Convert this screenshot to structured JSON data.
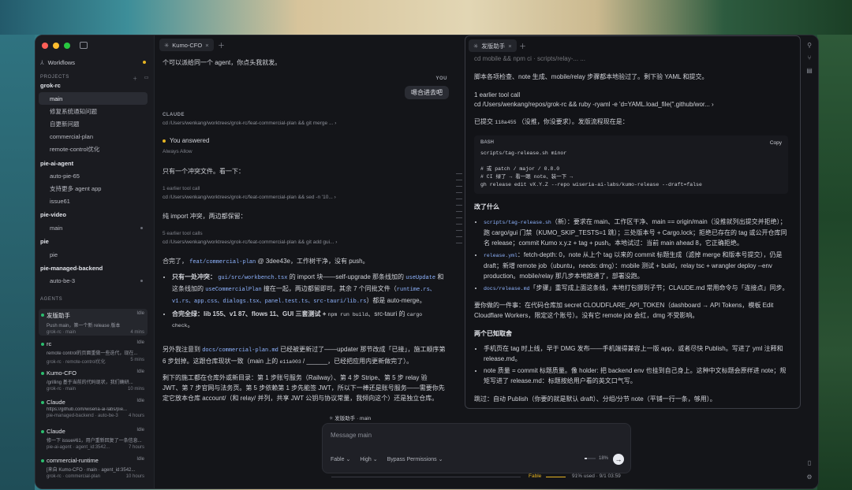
{
  "sidebar": {
    "workflows": "Workflows",
    "projects_header": "PROJECTS",
    "agents_header": "AGENTS",
    "projects": [
      {
        "name": "grok-rc",
        "branches": [
          "main",
          "修复系统通知问题",
          "自更新问题",
          "commercial-plan",
          "remote-control优化"
        ]
      },
      {
        "name": "pie-ai-agent",
        "branches": [
          "auto-pie-65",
          "支持更多 agent app",
          "issue61"
        ]
      },
      {
        "name": "pie-video",
        "branches": [
          "main"
        ]
      },
      {
        "name": "pie",
        "branches": [
          "pie"
        ]
      },
      {
        "name": "pie-managed-backend",
        "branches": [
          "auto-be-3"
        ]
      }
    ],
    "agents": [
      {
        "name": "发版助手",
        "status": "Idle",
        "msg": "Push main，第一个新 release 版本",
        "repo": "grok-rc · main",
        "time": "4 mins"
      },
      {
        "name": "rc",
        "status": "Idle",
        "msg": "remote control的页面重做一些迭代，现在...",
        "repo": "grok-rc · remote-control优化",
        "time": "5 mins"
      },
      {
        "name": "Kumo-CFO",
        "status": "Idle",
        "msg": "/grilling 基于当前的代码现状，我们确研...",
        "repo": "grok-rc · main",
        "time": "10 mins"
      },
      {
        "name": "Claude",
        "status": "Idle",
        "msg": "https://github.com/wiseria-ai-labs/pie...",
        "repo": "pie-managed-backend · auto-be-3",
        "time": "4 hours"
      },
      {
        "name": "Claude",
        "status": "Idle",
        "msg": "修一下 issue#61，用户重新回复了一条信息...",
        "repo": "pie-ai-agent · agent_id:3542...",
        "time": "7 hours"
      },
      {
        "name": "commercial-runtime",
        "status": "Idle",
        "msg": "[来自 Kumo-CFO · main · agent_id:3542...",
        "repo": "grok-rc · commercial-plan",
        "time": "10 hours"
      }
    ]
  },
  "center": {
    "tab": "Kumo-CFO",
    "line1": "个可以派给同一个 agent，你点头我就发。",
    "you_label": "YOU",
    "you_msg": "嗯合进去吧",
    "claude_label": "CLAUDE",
    "cmd1": "cd /Users/wenkang/worktrees/grok-rc/feat-commercial-plan && git merge ...",
    "answered": "You answered",
    "always_allow": "Always Allow",
    "conflict": "只有一个冲突文件。看一下：",
    "tc1": "1 earlier tool call",
    "cmd2": "cd /Users/wenkang/worktrees/grok-rc/feat-commercial-plan && sed -n '10...",
    "import_line": "纯 import 冲突，两边都保留：",
    "tc2": "5 earlier tool calls",
    "cmd3": "cd /Users/wenkang/worktrees/grok-rc/feat-commercial-plan && git add gui...",
    "merged_a": "合完了，",
    "merged_branch": "feat/commercial-plan",
    "merged_b": "@ 3dee43e，工作树干净，没有 push。",
    "b1_a": "只有一处冲突：",
    "b1_file": "gui/src/workbench.tsx",
    "b1_b": "的 import 块——self-upgrade 那条线加的",
    "b1_c": "useUpdate",
    "b1_d": "和这条线加的",
    "b1_e": "useCommercialPlan",
    "b1_f": "撞在一起，两边都留即可。其余 7 个同批文件（",
    "b1_g": "runtime.rs、v1.rs、app.css、dialogs.tsx、panel.test.ts、src-tauri/lib.rs",
    "b1_h": "）都是 auto-merge。",
    "b2_a": "合完全绿：lib 155、v1 87、flows 11、GUI 三套测试 +",
    "b2_b": "npm run build",
    "b2_c": "、src-tauri 的",
    "b2_d": "cargo check",
    "b2_e": "。",
    "p_a": "另外我注意到",
    "p_file": "docs/commercial-plan.md",
    "p_b": "已经被更新过了——updater 那节改成「已接」，施工顺序第 6 步划掉。这跟仓库现状一致（main 上的",
    "p_hash": "e11a003",
    "p_c": "/ ______，已经把应用内更新做完了）。",
    "p2": "剩下的施工都在仓库外或新目录：第 1 步账号服务（Railway）、第 4 步 Stripe、第 5 步 relay 验 JWT、第 7 步官网与法务页。第 5 步依赖第 1 步先能签 JWT，所以下一棒还是账号服务——需要你先定它放本仓库 account/（和 relay/ 并列，共享 JWT 公钥与协议常量，我倾向这个）还是独立仓库。"
  },
  "composer": {
    "title": "发版助手 · main",
    "placeholder": "Message main",
    "model": "Fable",
    "effort": "High",
    "permissions": "Bypass Permissions",
    "context_pct": "18%",
    "context_fill": 0.18,
    "status_model": "Fable",
    "status_usage": "91% used · 9/1 03:59"
  },
  "right": {
    "tab": "发版助手",
    "cut_line": "cd mobile && npm ci · scripts/relay-... ...",
    "p1": "脚本各项检查、note 生成、mobile/relay 步骤都本地验过了。剩下验 YAML 和提交。",
    "tc": "1 earlier tool call",
    "cmd": "cd /Users/wenkang/repos/grok-rc && ruby -ryaml -e 'd=YAML.load_file(\".github/wor...",
    "p2_a": "已提交",
    "p2_hash": "118a455",
    "p2_b": "（没推，你没要求）。发版流程现在是：",
    "code_label": "BASH",
    "copy": "Copy",
    "code_lines": [
      "scripts/tag-release.sh minor",
      "",
      "# 或 patch / major / 0.8.0",
      "# CI 绿了 → 看一眼 note、装一下 →",
      "gh release edit vX.Y.Z --repo wiseria-ai-labs/kumo-release --draft=false"
    ],
    "changed_h": "改了什么",
    "c1_file": "scripts/tag-release.sh",
    "c1_text": "（新）：要求在 main、工作区干净、main == origin/main（没推就列出提交并拒绝）；跑 cargo/gui 门禁（KUMO_SKIP_TESTS=1 跳）；三处版本号 + Cargo.lock；拒绝已存在的 tag 或公开仓库同名 release；commit Kumo x.y.z + tag + push。本地试过：当前 main ahead 8，它正确拒绝。",
    "c2_file": "release.yml",
    "c2_text": "：fetch-depth: 0，note 从上个 tag 以来的 commit 标题生成（滤掉 merge 和版本号提交），仍是 draft；新增 remote job（ubuntu，needs: dmg）：mobile 测试 + build，relay tsc + wrangler deploy --env production。mobile/relay 那几步本地跑通了，部署没跑。",
    "c3_file": "docs/release.md",
    "c3_text": "「步骤」重写成上面这条线，本地打包挪到子节；CLAUDE.md 常用命令与「连接点」同步。",
    "p3": "要你做的一件事：在代码仓库加 secret CLOUDFLARE_API_TOKEN（dashboard → API Tokens，模板 Edit Cloudflare Workers，限定这个账号）。没有它 remote job 会红，dmg 不受影响。",
    "known_h": "两个已知取舍",
    "k1": "手机页在 tag 时上线，早于 DMG 发布——手机端得兼容上一版 app，或者尽快 Publish。写进了 yml 注释和 release.md。",
    "k2": "note 质量 = commit 标题质量。像 holder: 把 backend env 也挂到自己身上。这种中文标题会原样进 note；规矩写进了 release.md：标题按给用户看的英文口气写。",
    "p4": "跳过：自动 Publish（你要的就是默认 draft）、分组/分节 note（平铺一行一条，够用）。"
  },
  "colors": {
    "accent": "#8fb4ff",
    "idle_dot": "#2bbd6e",
    "window_bg": "#141519"
  }
}
